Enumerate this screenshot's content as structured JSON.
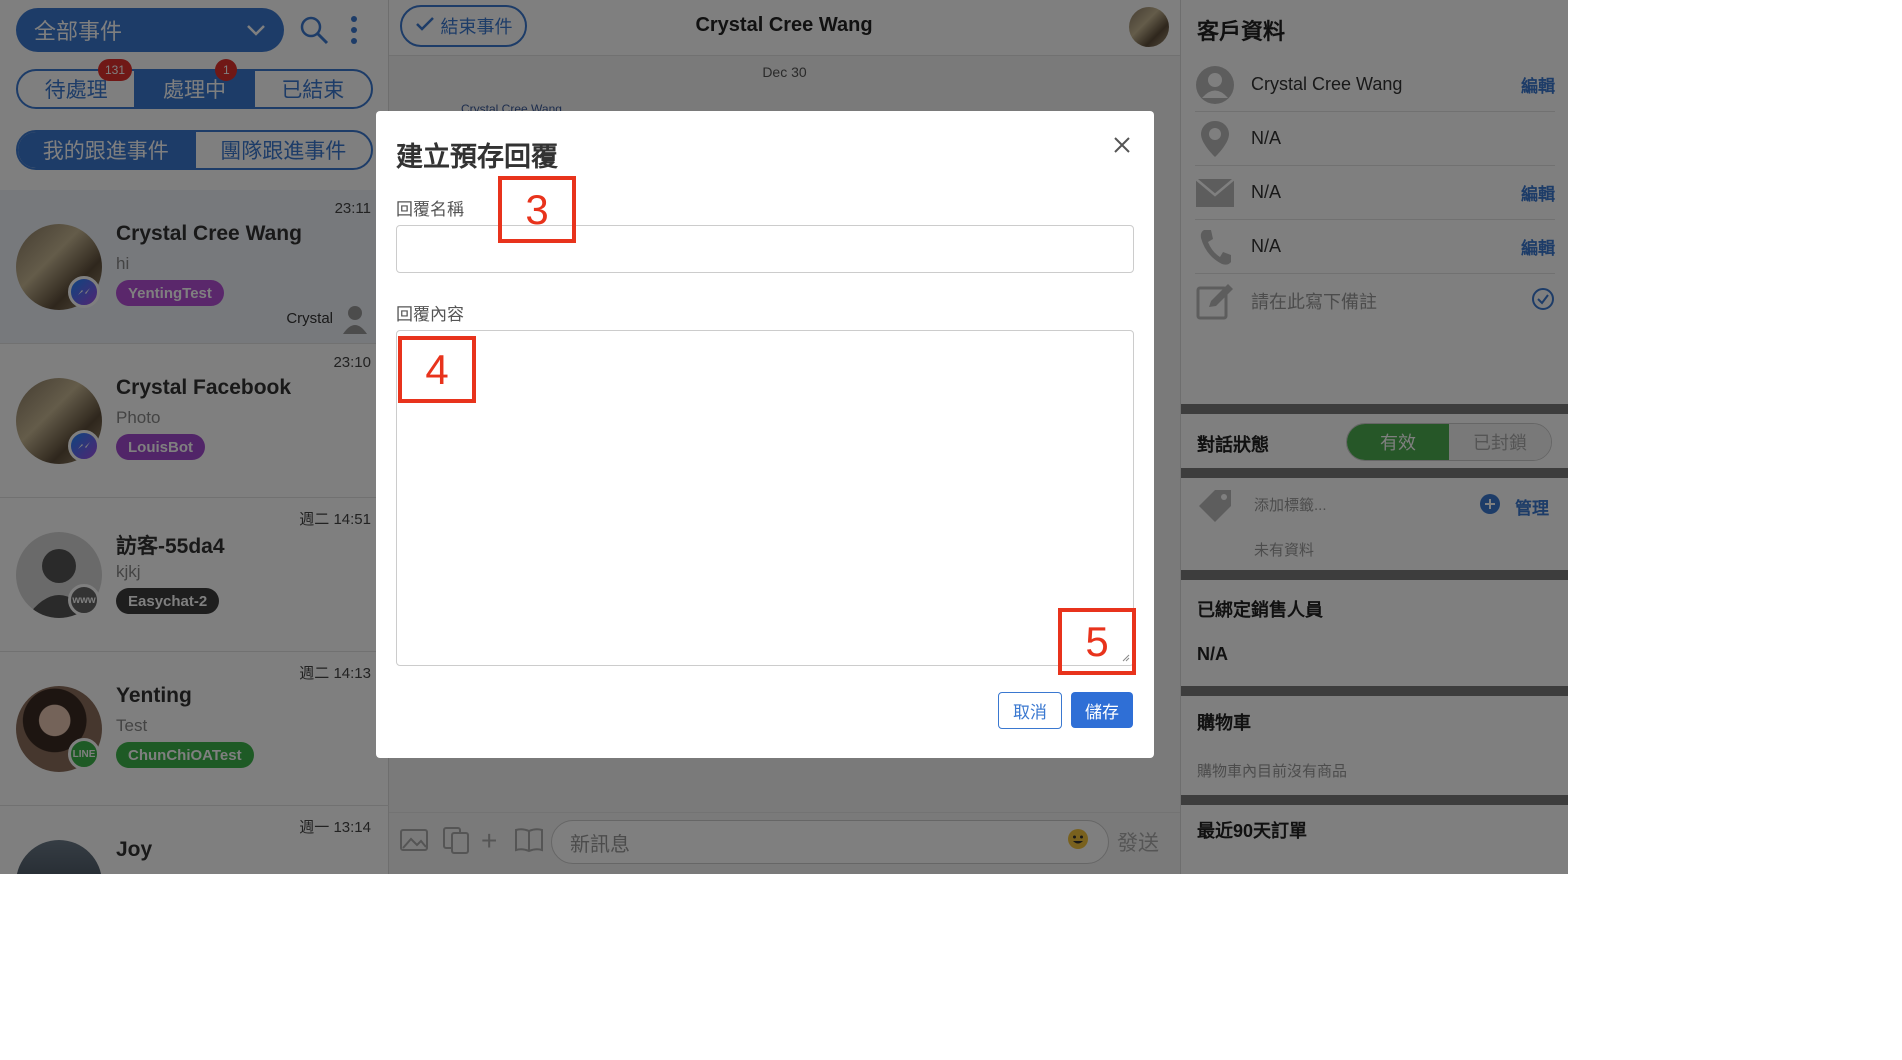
{
  "left": {
    "filter_label": "全部事件",
    "status_tabs": [
      {
        "label": "待處理",
        "badge": "131"
      },
      {
        "label": "處理中",
        "badge": "1"
      },
      {
        "label": "已結束",
        "badge": ""
      }
    ],
    "scope_tabs": [
      "我的跟進事件",
      "團隊跟進事件"
    ],
    "conversations": [
      {
        "name": "Crystal Cree Wang",
        "preview": "hi",
        "tag": "YentingTest",
        "tag_color": "#b44fd6",
        "time": "23:11",
        "agent": "Crystal",
        "channel": "messenger"
      },
      {
        "name": "Crystal Facebook",
        "preview": "Photo",
        "tag": "LouisBot",
        "tag_color": "#a34bd1",
        "time": "23:10",
        "agent": "",
        "channel": "messenger"
      },
      {
        "name": "訪客-55da4",
        "preview": "kjkj",
        "tag": "Easychat-2",
        "tag_color": "#3c3c3c",
        "time": "週二 14:51",
        "agent": "",
        "channel": "www"
      },
      {
        "name": "Yenting",
        "preview": "Test",
        "tag": "ChunChiOATest",
        "tag_color": "#3cb44a",
        "time": "週二 14:13",
        "agent": "",
        "channel": "line"
      },
      {
        "name": "Joy",
        "preview": "",
        "tag": "",
        "tag_color": "",
        "time": "週一 13:14",
        "agent": "",
        "channel": ""
      }
    ]
  },
  "center": {
    "end_button": "結束事件",
    "title": "Crystal Cree Wang",
    "date_label": "Dec 30",
    "sender_label": "Crystal Cree Wang",
    "message_placeholder": "新訊息",
    "send_label": "發送"
  },
  "right": {
    "title": "客戶資料",
    "rows": [
      {
        "text": "Crystal Cree Wang",
        "edit": "編輯"
      },
      {
        "text": "N/A",
        "edit": ""
      },
      {
        "text": "N/A",
        "edit": "編輯"
      },
      {
        "text": "N/A",
        "edit": "編輯"
      },
      {
        "text": "請在此寫下備註",
        "edit": ""
      }
    ],
    "conversation_status_label": "對話狀態",
    "status_active": "有效",
    "status_blocked": "已封鎖",
    "tag_placeholder": "添加標籤...",
    "manage_label": "管理",
    "no_data": "未有資料",
    "sales_label": "已綁定銷售人員",
    "sales_value": "N/A",
    "cart_label": "購物車",
    "cart_empty": "購物車內目前沒有商品",
    "orders_label": "最近90天訂單"
  },
  "modal": {
    "title": "建立預存回覆",
    "name_label": "回覆名稱",
    "content_label": "回覆內容",
    "cancel": "取消",
    "save": "儲存",
    "markers": [
      "3",
      "4",
      "5"
    ]
  },
  "colors": {
    "accent": "#3a78d0",
    "marker": "#e8331c",
    "active_green": "#4caf50"
  }
}
